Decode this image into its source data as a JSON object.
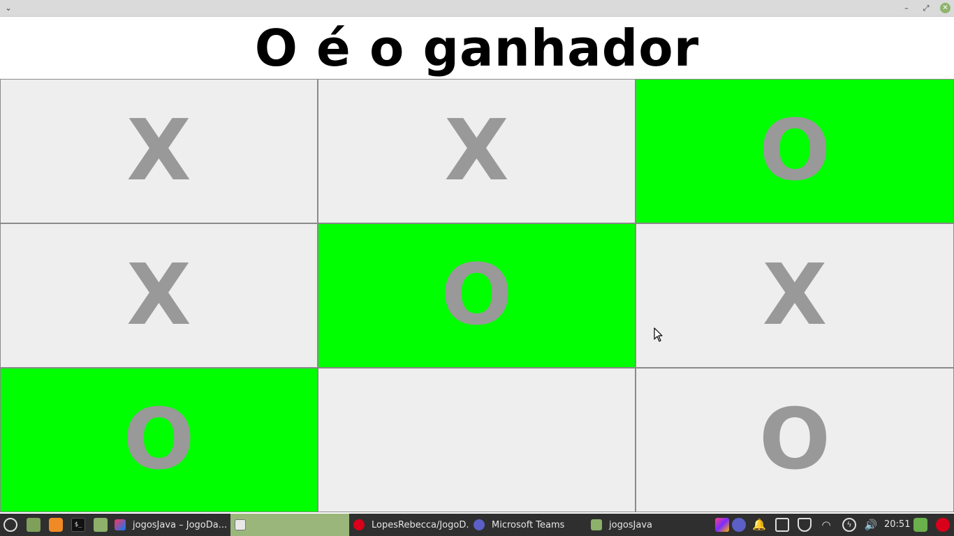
{
  "window": {
    "menu_icon": "chevron-down-icon",
    "minimize_label": "–",
    "maximize_label": "⤢",
    "close_label": "✕"
  },
  "header": {
    "title": "O é o ganhador"
  },
  "board": {
    "cells": [
      {
        "mark": "X",
        "winning": false
      },
      {
        "mark": "X",
        "winning": false
      },
      {
        "mark": "O",
        "winning": true
      },
      {
        "mark": "X",
        "winning": false
      },
      {
        "mark": "O",
        "winning": true
      },
      {
        "mark": "X",
        "winning": false
      },
      {
        "mark": "O",
        "winning": true
      },
      {
        "mark": "",
        "winning": false
      },
      {
        "mark": "O",
        "winning": false
      }
    ],
    "colors": {
      "cell": "#eeeeee",
      "winning": "#00ff00",
      "mark": "#999999"
    }
  },
  "taskbar": {
    "tasks": [
      {
        "label": "jogosJava – JogoDa...",
        "icon": "intellij-icon"
      },
      {
        "label": "",
        "icon": "java-app-icon"
      },
      {
        "label": "LopesRebecca/JogoD...",
        "icon": "opera-icon"
      },
      {
        "label": "Microsoft Teams",
        "icon": "teams-icon"
      },
      {
        "label": "jogosJava",
        "icon": "folder-icon"
      }
    ],
    "clock": "20:51"
  }
}
